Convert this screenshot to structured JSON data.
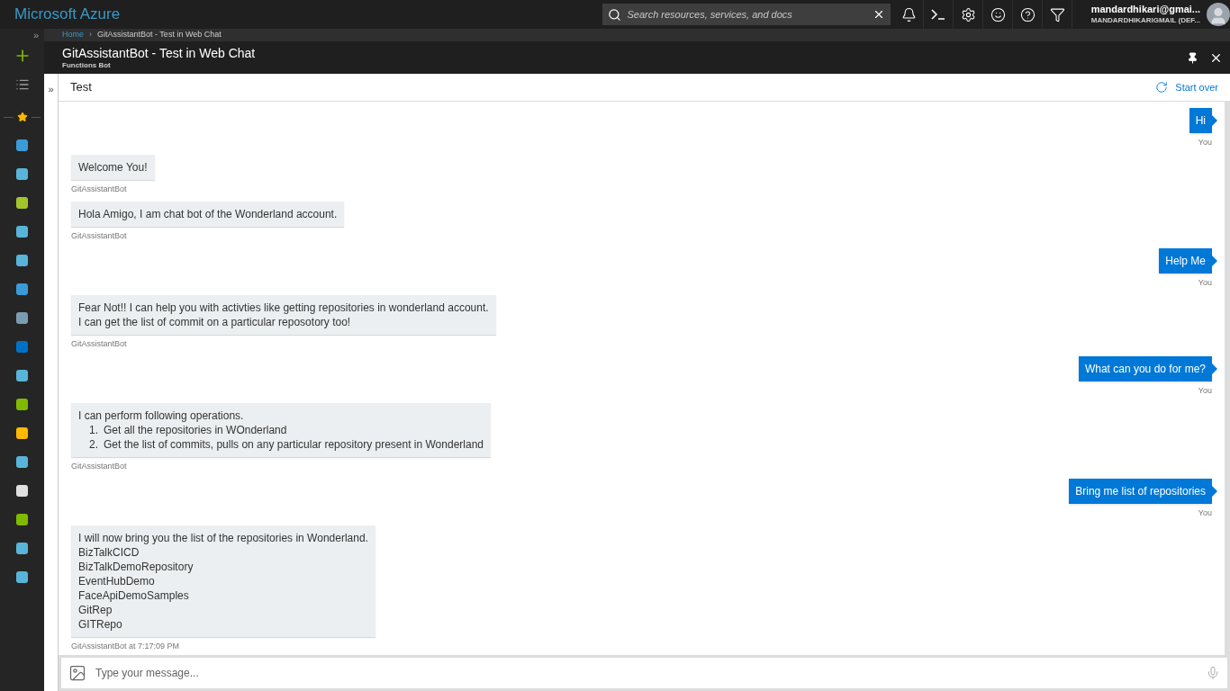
{
  "topbar": {
    "brand": "Microsoft Azure",
    "search": {
      "placeholder": "Search resources, services, and docs"
    },
    "account": {
      "email": "mandardhikari@gmai...",
      "directory": "MANDARDHIKARIGMAIL (DEF..."
    }
  },
  "sidebar": {
    "collapse": "»"
  },
  "breadcrumb": [
    "Home",
    "›",
    "GitAssistantBot - Test in Web Chat"
  ],
  "blade": {
    "title": "GitAssistantBot - Test in Web Chat",
    "subtitle": "Functions Bot"
  },
  "panel": {
    "expand": "»",
    "title": "Test",
    "start_over": "Start over"
  },
  "messages": [
    {
      "kind": "user",
      "lines": [
        "Hi"
      ],
      "caption": "You"
    },
    {
      "kind": "bot",
      "lines": [
        "Welcome You!"
      ],
      "caption": "GitAssistantBot"
    },
    {
      "kind": "bot",
      "lines": [
        "Hola Amigo, I am chat bot of the Wonderland account."
      ],
      "caption": "GitAssistantBot"
    },
    {
      "kind": "user",
      "lines": [
        "Help Me"
      ],
      "caption": "You"
    },
    {
      "kind": "bot",
      "lines": [
        "Fear Not!! I can help you with activties like getting repositories in wonderland account.",
        "I can get the list of commit on a particular reposotory too!"
      ],
      "caption": "GitAssistantBot"
    },
    {
      "kind": "user",
      "lines": [
        "What can you do for me?"
      ],
      "caption": "You"
    },
    {
      "kind": "bot",
      "lines": [
        "I can perform following operations."
      ],
      "list": [
        {
          "number": "1.",
          "text": "Get all the repositories in WOnderland"
        },
        {
          "number": "2.",
          "text": "Get the list of commits, pulls on any particular repository present in Wonderland"
        }
      ],
      "caption": "GitAssistantBot"
    },
    {
      "kind": "user",
      "lines": [
        "Bring me list of repositories"
      ],
      "caption": "You"
    },
    {
      "kind": "bot",
      "lines": [
        "I will now bring you the list of the repositories in Wonderland.",
        "BizTalkCICD",
        "BizTalkDemoRepository",
        "EventHubDemo",
        "FaceApiDemoSamples",
        "GitRep",
        "GITRepo"
      ],
      "caption": "GitAssistantBot at 7:17:09 PM"
    }
  ],
  "composer": {
    "placeholder": "Type your message..."
  }
}
